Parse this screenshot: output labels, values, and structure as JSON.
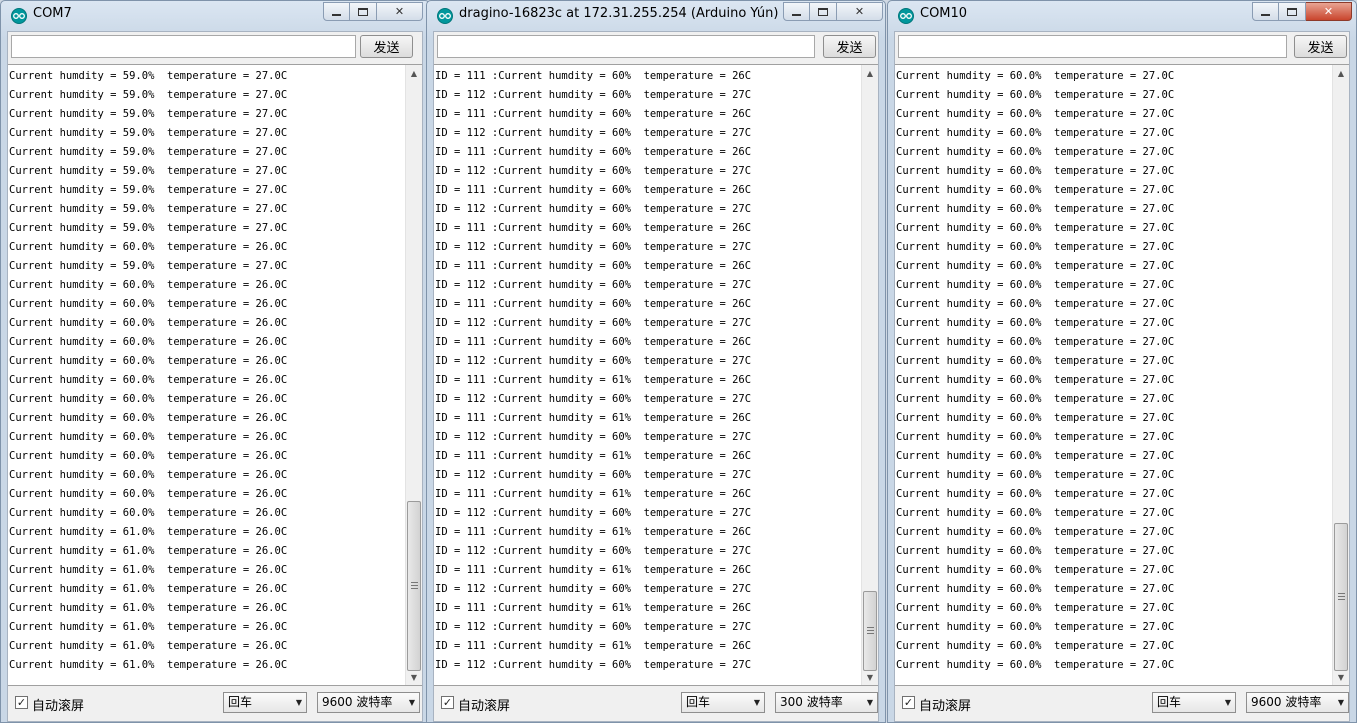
{
  "windows": [
    {
      "title": "COM7",
      "send_label": "发送",
      "send_value": "",
      "autoscroll_label": "自动滚屏",
      "autoscroll_checked": true,
      "line_ending": "回车",
      "baud": "9600  波特率",
      "lines": [
        "Current humdity = 59.0%  temperature = 27.0C",
        "Current humdity = 59.0%  temperature = 27.0C",
        "Current humdity = 59.0%  temperature = 27.0C",
        "Current humdity = 59.0%  temperature = 27.0C",
        "Current humdity = 59.0%  temperature = 27.0C",
        "Current humdity = 59.0%  temperature = 27.0C",
        "Current humdity = 59.0%  temperature = 27.0C",
        "Current humdity = 59.0%  temperature = 27.0C",
        "Current humdity = 59.0%  temperature = 27.0C",
        "Current humdity = 60.0%  temperature = 26.0C",
        "Current humdity = 59.0%  temperature = 27.0C",
        "Current humdity = 60.0%  temperature = 26.0C",
        "Current humdity = 60.0%  temperature = 26.0C",
        "Current humdity = 60.0%  temperature = 26.0C",
        "Current humdity = 60.0%  temperature = 26.0C",
        "Current humdity = 60.0%  temperature = 26.0C",
        "Current humdity = 60.0%  temperature = 26.0C",
        "Current humdity = 60.0%  temperature = 26.0C",
        "Current humdity = 60.0%  temperature = 26.0C",
        "Current humdity = 60.0%  temperature = 26.0C",
        "Current humdity = 60.0%  temperature = 26.0C",
        "Current humdity = 60.0%  temperature = 26.0C",
        "Current humdity = 60.0%  temperature = 26.0C",
        "Current humdity = 60.0%  temperature = 26.0C",
        "Current humdity = 61.0%  temperature = 26.0C",
        "Current humdity = 61.0%  temperature = 26.0C",
        "Current humdity = 61.0%  temperature = 26.0C",
        "Current humdity = 61.0%  temperature = 26.0C",
        "Current humdity = 61.0%  temperature = 26.0C",
        "Current humdity = 61.0%  temperature = 26.0C",
        "Current humdity = 61.0%  temperature = 26.0C",
        "Current humdity = 61.0%  temperature = 26.0C"
      ]
    },
    {
      "title": "dragino-16823c at 172.31.255.254 (Arduino Yún)",
      "send_label": "发送",
      "send_value": "",
      "autoscroll_label": "自动滚屏",
      "autoscroll_checked": true,
      "line_ending": "回车",
      "baud": "300  波特率",
      "lines": [
        "ID = 111 :Current humdity = 60%  temperature = 26C",
        "ID = 112 :Current humdity = 60%  temperature = 27C",
        "ID = 111 :Current humdity = 60%  temperature = 26C",
        "ID = 112 :Current humdity = 60%  temperature = 27C",
        "ID = 111 :Current humdity = 60%  temperature = 26C",
        "ID = 112 :Current humdity = 60%  temperature = 27C",
        "ID = 111 :Current humdity = 60%  temperature = 26C",
        "ID = 112 :Current humdity = 60%  temperature = 27C",
        "ID = 111 :Current humdity = 60%  temperature = 26C",
        "ID = 112 :Current humdity = 60%  temperature = 27C",
        "ID = 111 :Current humdity = 60%  temperature = 26C",
        "ID = 112 :Current humdity = 60%  temperature = 27C",
        "ID = 111 :Current humdity = 60%  temperature = 26C",
        "ID = 112 :Current humdity = 60%  temperature = 27C",
        "ID = 111 :Current humdity = 60%  temperature = 26C",
        "ID = 112 :Current humdity = 60%  temperature = 27C",
        "ID = 111 :Current humdity = 61%  temperature = 26C",
        "ID = 112 :Current humdity = 60%  temperature = 27C",
        "ID = 111 :Current humdity = 61%  temperature = 26C",
        "ID = 112 :Current humdity = 60%  temperature = 27C",
        "ID = 111 :Current humdity = 61%  temperature = 26C",
        "ID = 112 :Current humdity = 60%  temperature = 27C",
        "ID = 111 :Current humdity = 61%  temperature = 26C",
        "ID = 112 :Current humdity = 60%  temperature = 27C",
        "ID = 111 :Current humdity = 61%  temperature = 26C",
        "ID = 112 :Current humdity = 60%  temperature = 27C",
        "ID = 111 :Current humdity = 61%  temperature = 26C",
        "ID = 112 :Current humdity = 60%  temperature = 27C",
        "ID = 111 :Current humdity = 61%  temperature = 26C",
        "ID = 112 :Current humdity = 60%  temperature = 27C",
        "ID = 111 :Current humdity = 61%  temperature = 26C",
        "ID = 112 :Current humdity = 60%  temperature = 27C"
      ]
    },
    {
      "title": "COM10",
      "send_label": "发送",
      "send_value": "",
      "autoscroll_label": "自动滚屏",
      "autoscroll_checked": true,
      "line_ending": "回车",
      "baud": "9600  波特率",
      "lines": [
        "Current humdity = 60.0%  temperature = 27.0C",
        "Current humdity = 60.0%  temperature = 27.0C",
        "Current humdity = 60.0%  temperature = 27.0C",
        "Current humdity = 60.0%  temperature = 27.0C",
        "Current humdity = 60.0%  temperature = 27.0C",
        "Current humdity = 60.0%  temperature = 27.0C",
        "Current humdity = 60.0%  temperature = 27.0C",
        "Current humdity = 60.0%  temperature = 27.0C",
        "Current humdity = 60.0%  temperature = 27.0C",
        "Current humdity = 60.0%  temperature = 27.0C",
        "Current humdity = 60.0%  temperature = 27.0C",
        "Current humdity = 60.0%  temperature = 27.0C",
        "Current humdity = 60.0%  temperature = 27.0C",
        "Current humdity = 60.0%  temperature = 27.0C",
        "Current humdity = 60.0%  temperature = 27.0C",
        "Current humdity = 60.0%  temperature = 27.0C",
        "Current humdity = 60.0%  temperature = 27.0C",
        "Current humdity = 60.0%  temperature = 27.0C",
        "Current humdity = 60.0%  temperature = 27.0C",
        "Current humdity = 60.0%  temperature = 27.0C",
        "Current humdity = 60.0%  temperature = 27.0C",
        "Current humdity = 60.0%  temperature = 27.0C",
        "Current humdity = 60.0%  temperature = 27.0C",
        "Current humdity = 60.0%  temperature = 27.0C",
        "Current humdity = 60.0%  temperature = 27.0C",
        "Current humdity = 60.0%  temperature = 27.0C",
        "Current humdity = 60.0%  temperature = 27.0C",
        "Current humdity = 60.0%  temperature = 27.0C",
        "Current humdity = 60.0%  temperature = 27.0C",
        "Current humdity = 60.0%  temperature = 27.0C",
        "Current humdity = 60.0%  temperature = 27.0C",
        "Current humdity = 60.0%  temperature = 27.0C"
      ]
    }
  ],
  "icons": {
    "app": "arduino-icon",
    "minimize": "minimize-icon",
    "maximize": "maximize-icon",
    "close": "close-icon",
    "scroll_up": "scroll-up-arrow-icon",
    "scroll_down": "scroll-down-arrow-icon",
    "dropdown": "chevron-down-icon"
  },
  "colors": {
    "arduino_teal": "#00979c",
    "close_red": "#c9452d"
  }
}
